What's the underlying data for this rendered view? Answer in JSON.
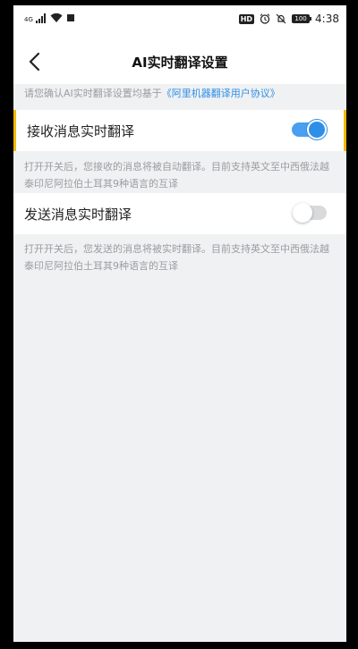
{
  "status_bar": {
    "network_tag": "4G",
    "time": "4:38",
    "hd": "HD",
    "battery": "100",
    "icons": [
      "signal-icon",
      "wifi-icon",
      "notification-icon",
      "alarm-icon",
      "mute-icon",
      "battery-icon"
    ]
  },
  "header": {
    "title": "AI实时翻译设置",
    "back_icon": "back-arrow-icon"
  },
  "notice": {
    "prefix": "请您确认AI实时翻译设置均基于",
    "link": "《阿里机器翻译用户协议》"
  },
  "settings": [
    {
      "label": "接收消息实时翻译",
      "enabled": true,
      "description": "打开开关后，您接收的消息将被自动翻译。目前支持英文至中西俄法越泰印尼阿拉伯土耳其9种语言的互译"
    },
    {
      "label": "发送消息实时翻译",
      "enabled": false,
      "description": "打开开关后，您发送的消息将被实时翻译。目前支持英文至中西俄法越泰印尼阿拉伯土耳其9种语言的互译"
    }
  ],
  "colors": {
    "accent": "#2f8fe8",
    "highlight_border": "#f5b800",
    "background": "#f0f1f2",
    "muted_text": "#9a9ca0"
  }
}
